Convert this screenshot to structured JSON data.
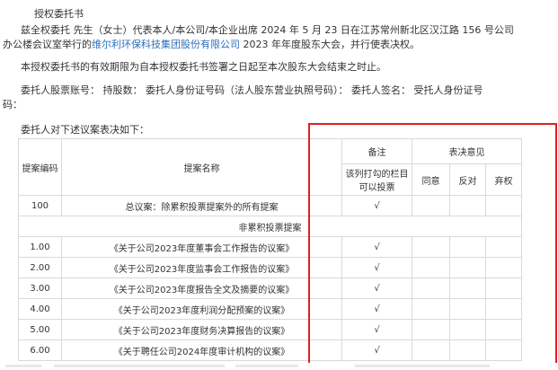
{
  "title": "授权委托书",
  "paragraph1_line1": "兹全权委托  先生（女士）代表本人/本公司/本企业出席 2024 年 5 月 23 日在江苏常州新北区汉江路 156 号公司",
  "paragraph1_line2_prefix": "办公楼会议室举行的",
  "paragraph1_company": "维尔利环保科技集团股份有限公司",
  "paragraph1_line2_suffix": " 2023 年年度股东大会，并行使表决权。",
  "paragraph2": "本授权委托书的有效期限为自本授权委托书签署之日起至本次股东大会结束之时止。",
  "paragraph3": "委托人股票账号：  持股数：  委托人身份证号码（法人股东营业执照号码）：  委托人签名：  受托人身份证号",
  "paragraph3_cont": "码：",
  "table_intro": "委托人对下述议案表决如下：",
  "table": {
    "header_proposal_no": "提案编码",
    "header_proposal_name": "提案名称",
    "header_remark": "备注",
    "header_remark_sub": "该列打勾的栏目可以投票",
    "header_vote": "表决意见",
    "header_agree": "同意",
    "header_oppose": "反对",
    "header_abstain": "弃权",
    "section_non_cumulative": "非累积投票提案",
    "rows": [
      {
        "code": "100",
        "name": "总议案：除累积投票提案外的所有提案",
        "mark": "√"
      },
      {
        "code": "1.00",
        "name": "《关于公司2023年度董事会工作报告的议案》",
        "mark": "√"
      },
      {
        "code": "2.00",
        "name": "《关于公司2023年度监事会工作报告的议案》",
        "mark": "√"
      },
      {
        "code": "3.00",
        "name": "《关于公司2023年度报告全文及摘要的议案》",
        "mark": "√"
      },
      {
        "code": "4.00",
        "name": "《关于公司2023年度利润分配预案的议案》",
        "mark": "√"
      },
      {
        "code": "5.00",
        "name": "《关于公司2023年度财务决算报告的议案》",
        "mark": "√"
      },
      {
        "code": "6.00",
        "name": "《关于聘任公司2024年度审计机构的议案》",
        "mark": "√"
      }
    ]
  },
  "highlight_color": "#e02020",
  "link_color": "#2d6fbe"
}
